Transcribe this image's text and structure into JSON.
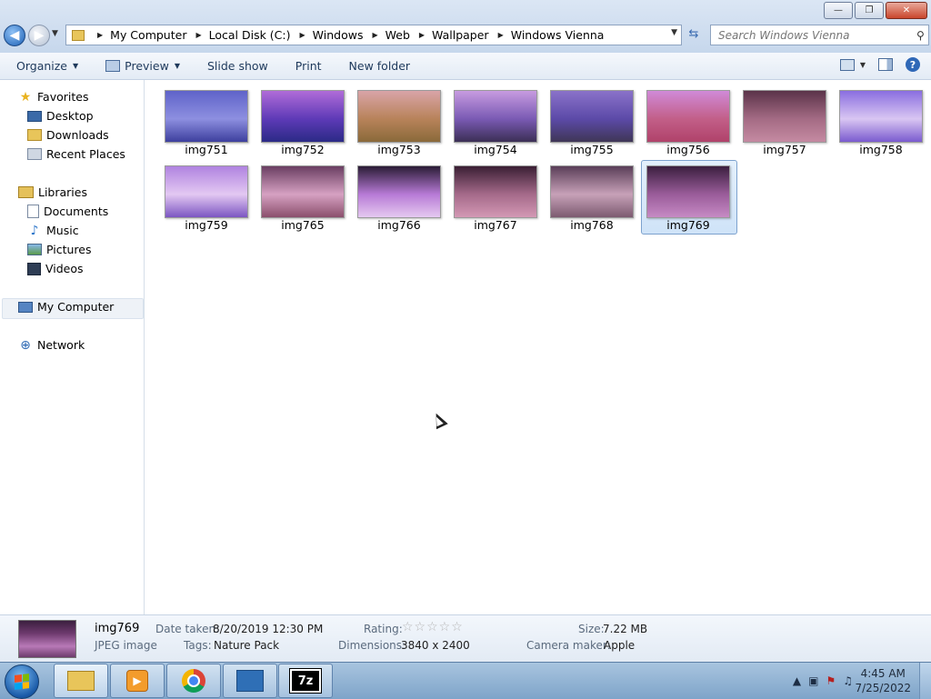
{
  "window": {
    "caption_buttons": {
      "minimize": "—",
      "maximize": "❐",
      "close": "✕"
    }
  },
  "address": {
    "crumbs": [
      "My Computer",
      "Local Disk (C:)",
      "Windows",
      "Web",
      "Wallpaper",
      "Windows Vienna"
    ]
  },
  "search": {
    "placeholder": "Search Windows Vienna"
  },
  "toolbar": {
    "organize": "Organize",
    "preview": "Preview",
    "slideshow": "Slide show",
    "print": "Print",
    "new_folder": "New folder"
  },
  "nav": {
    "favorites": "Favorites",
    "desktop": "Desktop",
    "downloads": "Downloads",
    "recent_places": "Recent Places",
    "libraries": "Libraries",
    "documents": "Documents",
    "music": "Music",
    "pictures": "Pictures",
    "videos": "Videos",
    "my_computer": "My Computer",
    "network": "Network"
  },
  "files": [
    {
      "name": "img751",
      "selected": false,
      "palette": [
        "#5f63c9",
        "#8d8fe0",
        "#3d3f9e"
      ]
    },
    {
      "name": "img752",
      "selected": false,
      "palette": [
        "#b06cd8",
        "#5e3ab7",
        "#2b2a86"
      ]
    },
    {
      "name": "img753",
      "selected": false,
      "palette": [
        "#d9a4a8",
        "#b8835a",
        "#8a6a3a"
      ]
    },
    {
      "name": "img754",
      "selected": false,
      "palette": [
        "#c79be0",
        "#7a5ab4",
        "#3b2f55"
      ]
    },
    {
      "name": "img755",
      "selected": false,
      "palette": [
        "#8a72c9",
        "#5c4aa8",
        "#3f3656"
      ]
    },
    {
      "name": "img756",
      "selected": false,
      "palette": [
        "#d08ad8",
        "#c25f88",
        "#b0426a"
      ]
    },
    {
      "name": "img757",
      "selected": false,
      "palette": [
        "#5b3349",
        "#a46b84",
        "#c58aa2"
      ]
    },
    {
      "name": "img758",
      "selected": false,
      "palette": [
        "#8a6ee0",
        "#d9c6f2",
        "#7a5bcf"
      ]
    },
    {
      "name": "img759",
      "selected": false,
      "palette": [
        "#b083e0",
        "#e3c8f2",
        "#7c56c2"
      ]
    },
    {
      "name": "img765",
      "selected": false,
      "palette": [
        "#6a3e62",
        "#d6a1c2",
        "#8a4f6c"
      ]
    },
    {
      "name": "img766",
      "selected": false,
      "palette": [
        "#2a1c35",
        "#b77ad6",
        "#e5c9f0"
      ]
    },
    {
      "name": "img767",
      "selected": false,
      "palette": [
        "#3a1f34",
        "#a56a8a",
        "#d398b4"
      ]
    },
    {
      "name": "img768",
      "selected": false,
      "palette": [
        "#5a3e58",
        "#c7a1b8",
        "#7c5a70"
      ]
    },
    {
      "name": "img769",
      "selected": true,
      "palette": [
        "#3b1f3f",
        "#9a5c9a",
        "#c68ac4"
      ]
    }
  ],
  "details": {
    "name": "img769",
    "type": "JPEG image",
    "date_taken_label": "Date taken:",
    "date_taken": "8/20/2019 12:30 PM",
    "tags_label": "Tags:",
    "tags": "Nature Pack",
    "rating_label": "Rating:",
    "rating_stars": "☆☆☆☆☆",
    "rating": 0,
    "dimensions_label": "Dimensions:",
    "dimensions": "3840 x 2400",
    "size_label": "Size:",
    "size": "7.22 MB",
    "camera_label": "Camera maker:",
    "camera": "Apple"
  },
  "taskbar": {
    "apps": [
      "windows-explorer",
      "media-player",
      "chrome",
      "control-panel",
      "7zip"
    ],
    "seven_zip_label": "7z",
    "clock_time": "4:45 AM",
    "clock_date": "7/25/2022"
  },
  "colors": {
    "chrome_gradient_top": "#dbe6f4",
    "selection": "#cfe3f8",
    "taskbar": "#7ea4c9"
  }
}
